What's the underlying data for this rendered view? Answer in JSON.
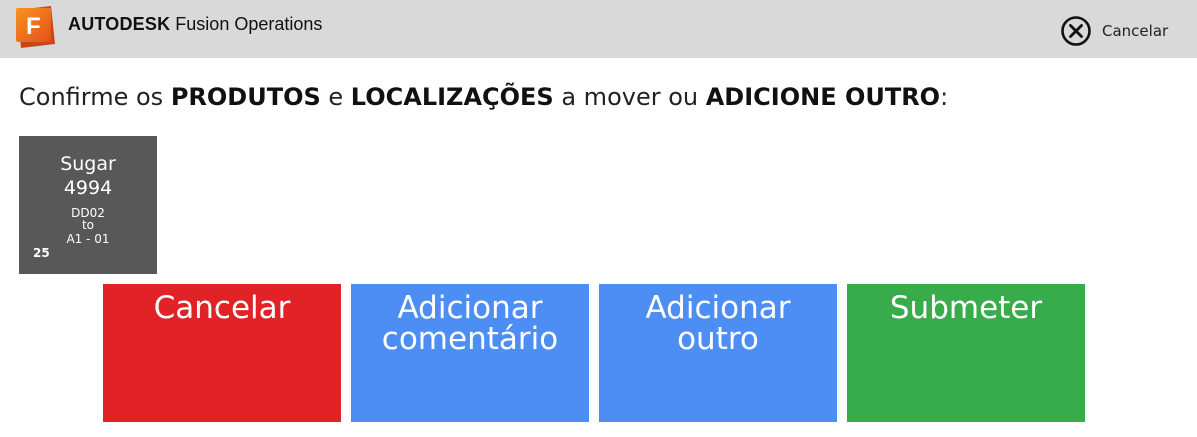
{
  "header": {
    "brand_bold": "AUTODESK",
    "brand_product": "Fusion Operations",
    "logo_letter": "F",
    "logo_icon": "fusion-logo-icon",
    "cancel_label": "Cancelar",
    "cancel_icon": "close-circle-icon"
  },
  "prompt": {
    "p1": "Confirme os ",
    "b1": "PRODUTOS",
    "p2": " e ",
    "b2": "LOCALIZAÇÕES",
    "p3": " a mover ou ",
    "b3": "ADICIONE OUTRO",
    "p4": ":"
  },
  "items": [
    {
      "name": "Sugar",
      "number": "4994",
      "from": "DD02",
      "to_word": "to",
      "to": "A1 - 01",
      "quantity": "25"
    }
  ],
  "actions": {
    "cancel": {
      "line1": "Cancelar",
      "line2": ""
    },
    "comment": {
      "line1": "Adicionar",
      "line2": "comentário"
    },
    "other": {
      "line1": "Adicionar",
      "line2": "outro"
    },
    "submit": {
      "line1": "Submeter",
      "line2": ""
    }
  },
  "colors": {
    "header_bg": "#d9d9d9",
    "tile_bg": "#585858",
    "cancel": "#e12227",
    "blue": "#4d8ef5",
    "submit": "#38ac4a",
    "logo_orange": "#f26a21"
  }
}
